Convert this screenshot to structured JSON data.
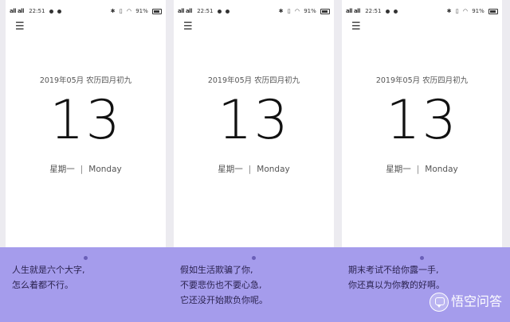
{
  "status_bar": {
    "signal_text": "all all",
    "time": "22:51",
    "battery": "91%"
  },
  "phones": [
    {
      "date_line": "2019年05月 农历四月初九",
      "day": "13",
      "weekday_cn": "星期一",
      "separator": "|",
      "weekday_en": "Monday",
      "caption": [
        "人生就是六个大字,",
        "怎么着都不行。"
      ]
    },
    {
      "date_line": "2019年05月 农历四月初九",
      "day": "13",
      "weekday_cn": "星期一",
      "separator": "|",
      "weekday_en": "Monday",
      "caption": [
        "假如生活欺骗了你,",
        "不要悲伤也不要心急,",
        "它还没开始欺负你呢。"
      ]
    },
    {
      "date_line": "2019年05月 农历四月初九",
      "day": "13",
      "weekday_cn": "星期一",
      "separator": "|",
      "weekday_en": "Monday",
      "caption": [
        "期末考试不给你露一手,",
        "你还真以为你教的好啊。"
      ]
    }
  ],
  "watermark": {
    "text": "悟空问答",
    "icon": "speech-bubble-icon"
  },
  "colors": {
    "band": "#a59cec",
    "caption_text": "#2b2350",
    "screen": "#ffffff"
  }
}
